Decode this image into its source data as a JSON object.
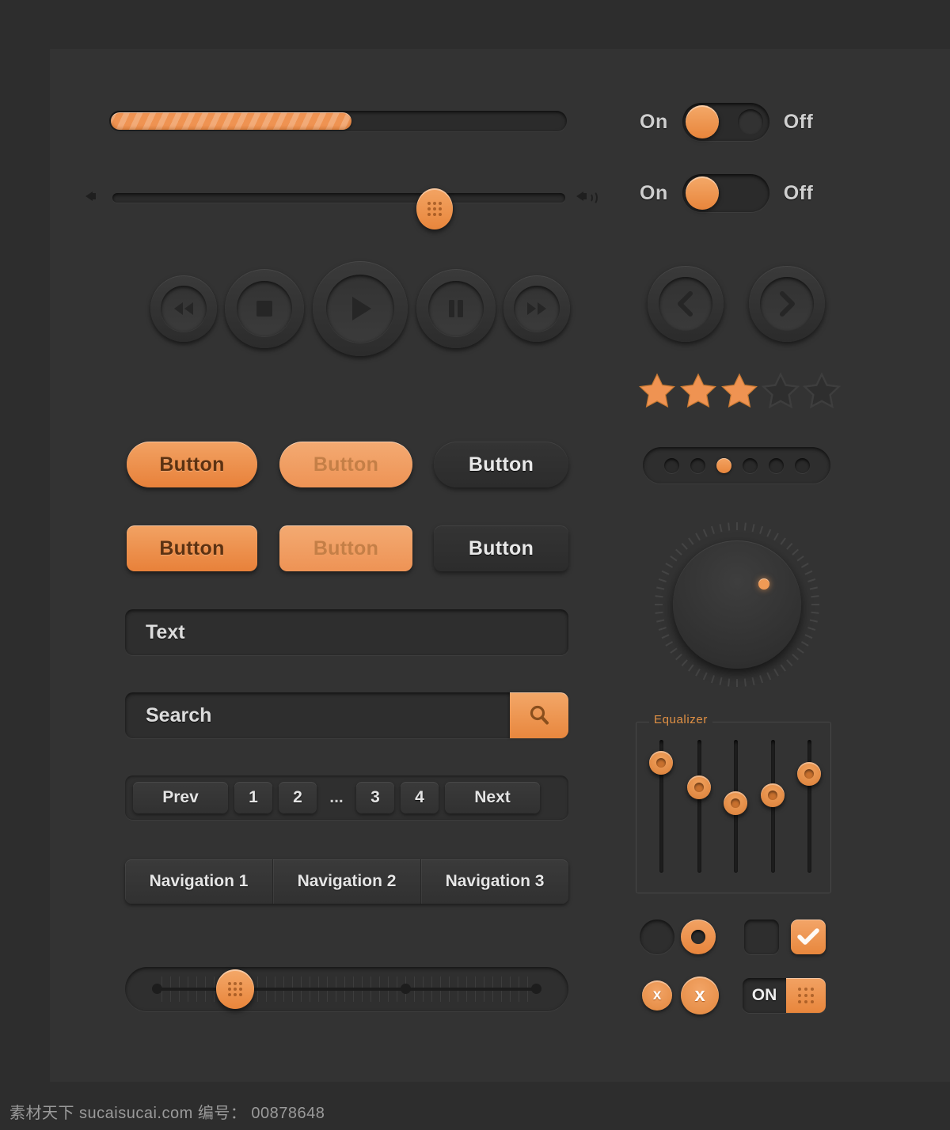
{
  "theme": {
    "page_bg": "#2d2d2d",
    "panel_bg": "#333333",
    "accent": "#ef8f45",
    "accent_light": "#f3aa72",
    "text_light": "#e6e6e6",
    "text_on_accent": "#5c3212"
  },
  "progress": {
    "name": "progress-bar",
    "value_percent": 53,
    "striped": true
  },
  "volume_slider": {
    "left_icon": "speaker-mute-icon",
    "right_icon": "speaker-volume-icon",
    "value_percent": 69
  },
  "toggles": [
    {
      "on_label": "On",
      "off_label": "Off",
      "state": "on",
      "shape": "pill"
    },
    {
      "on_label": "On",
      "off_label": "Off",
      "state": "on",
      "shape": "pill-flat"
    }
  ],
  "transport": {
    "buttons": [
      {
        "icon": "rewind-icon",
        "label": "Rewind"
      },
      {
        "icon": "stop-icon",
        "label": "Stop"
      },
      {
        "icon": "play-icon",
        "label": "Play"
      },
      {
        "icon": "pause-icon",
        "label": "Pause"
      },
      {
        "icon": "fast-forward-icon",
        "label": "Fast Forward"
      }
    ]
  },
  "arrow_nav": {
    "prev_icon": "chevron-left-icon",
    "next_icon": "chevron-right-icon"
  },
  "rating": {
    "total": 5,
    "filled": 3,
    "icon": "star-icon"
  },
  "dot_pager": {
    "total": 6,
    "active_index": 3
  },
  "knob": {
    "name": "rotary-knob",
    "indicator_angle_deg": 40,
    "tick_count": 60
  },
  "buttons": {
    "row1": [
      {
        "label": "Button",
        "style": "solid",
        "shape": "pill"
      },
      {
        "label": "Button",
        "style": "muted",
        "shape": "pill"
      },
      {
        "label": "Button",
        "style": "dark",
        "shape": "pill"
      }
    ],
    "row2": [
      {
        "label": "Button",
        "style": "solid",
        "shape": "rect"
      },
      {
        "label": "Button",
        "style": "muted",
        "shape": "rect"
      },
      {
        "label": "Button",
        "style": "dark",
        "shape": "rect"
      }
    ]
  },
  "text_input": {
    "value": "Text",
    "placeholder": "Text"
  },
  "search": {
    "value": "Search",
    "placeholder": "Search",
    "button_icon": "search-icon"
  },
  "pagination": {
    "prev_label": "Prev",
    "next_label": "Next",
    "pages": [
      "1",
      "2",
      "...",
      "3",
      "4"
    ]
  },
  "nav_tabs": [
    {
      "label": "Navigation 1"
    },
    {
      "label": "Navigation 2"
    },
    {
      "label": "Navigation 3"
    }
  ],
  "range_slider": {
    "value_percent": 22,
    "stop_count": 3,
    "ticks": true
  },
  "equalizer": {
    "legend": "Equalizer",
    "bands": [
      {
        "index": 1,
        "value_percent": 88
      },
      {
        "index": 2,
        "value_percent": 72
      },
      {
        "index": 3,
        "value_percent": 60
      },
      {
        "index": 4,
        "value_percent": 66
      },
      {
        "index": 5,
        "value_percent": 80
      }
    ]
  },
  "choice_controls": {
    "radio_unchecked": {
      "name": "radio-unchecked",
      "state": "off"
    },
    "radio_checked": {
      "name": "radio-checked",
      "state": "on"
    },
    "checkbox_unchecked": {
      "name": "checkbox-unchecked",
      "state": "off"
    },
    "checkbox_checked": {
      "name": "checkbox-checked",
      "state": "on",
      "icon": "check-icon"
    }
  },
  "close_buttons": [
    {
      "icon": "close-icon",
      "size": "small",
      "label": "x"
    },
    {
      "icon": "close-icon",
      "size": "large",
      "label": "x"
    }
  ],
  "on_switch": {
    "label": "ON",
    "grip_icon": "grip-dots-icon",
    "state": "on"
  },
  "watermark": {
    "text": "素材天下 sucaisucai.com  编号： 00878648"
  }
}
